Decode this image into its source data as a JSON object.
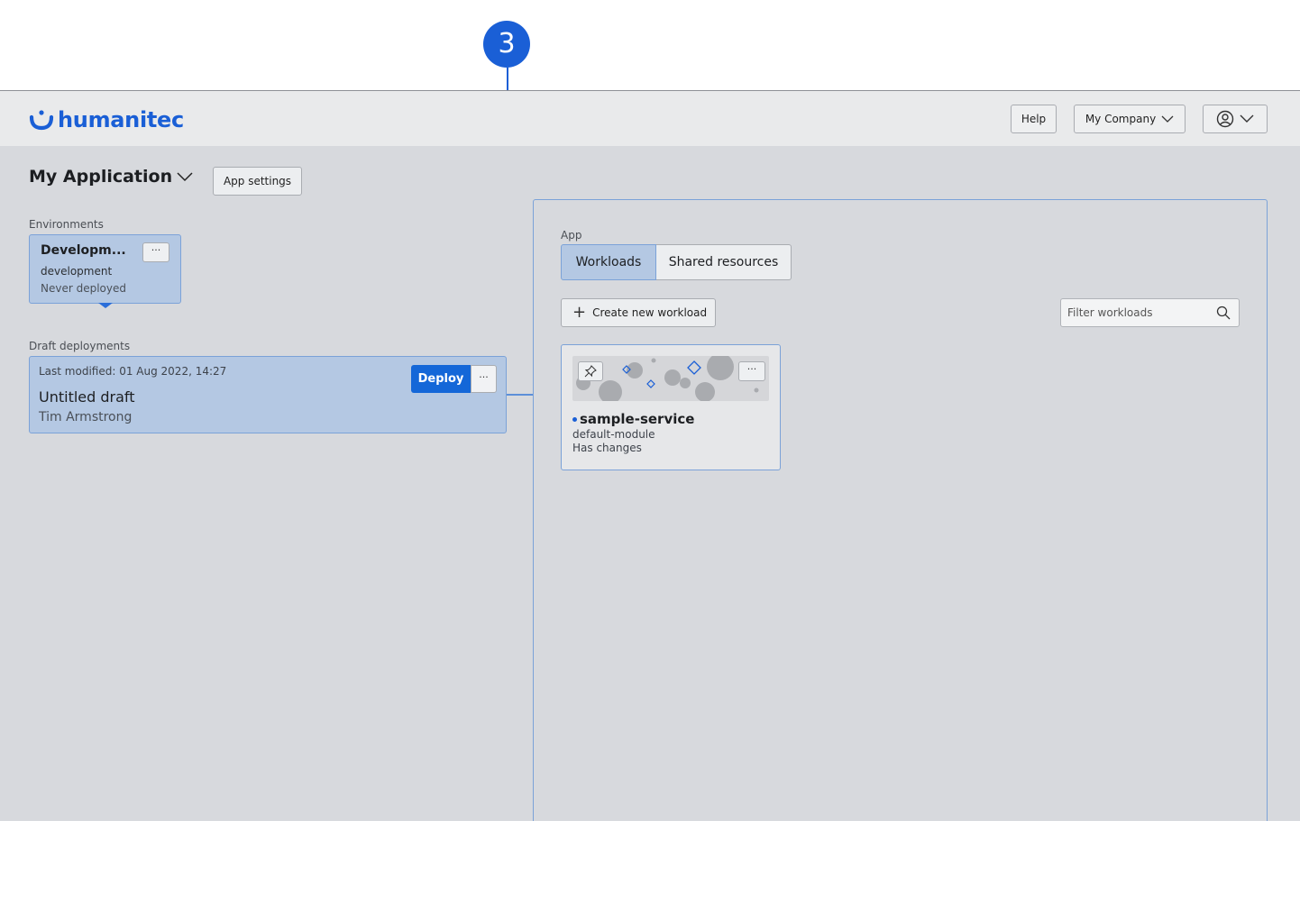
{
  "callout": {
    "number": "3"
  },
  "topbar": {
    "logo_text": "humanitec",
    "help_label": "Help",
    "company_label": "My Company"
  },
  "app": {
    "title": "My Application",
    "settings_label": "App settings"
  },
  "environments": {
    "label": "Environments",
    "card": {
      "name": "Developm...",
      "id": "development",
      "status": "Never deployed",
      "more_label": "···"
    }
  },
  "drafts": {
    "label": "Draft deployments",
    "card": {
      "modified": "Last modified: 01 Aug 2022, 14:27",
      "title": "Untitled draft",
      "author": "Tim Armstrong",
      "deploy_label": "Deploy",
      "more_label": "···"
    }
  },
  "panel": {
    "label": "App",
    "tabs": [
      {
        "label": "Workloads",
        "active": true
      },
      {
        "label": "Shared resources",
        "active": false
      }
    ],
    "create_label": "Create new workload",
    "filter_placeholder": "Filter workloads",
    "workload": {
      "name": "sample-service",
      "module": "default-module",
      "status": "Has changes",
      "more_label": "···"
    }
  },
  "colors": {
    "accent": "#1a5fd6",
    "deploy_button": "#1467d8",
    "selected_card": "#b4c8e3",
    "background": "#d7d9dd"
  }
}
